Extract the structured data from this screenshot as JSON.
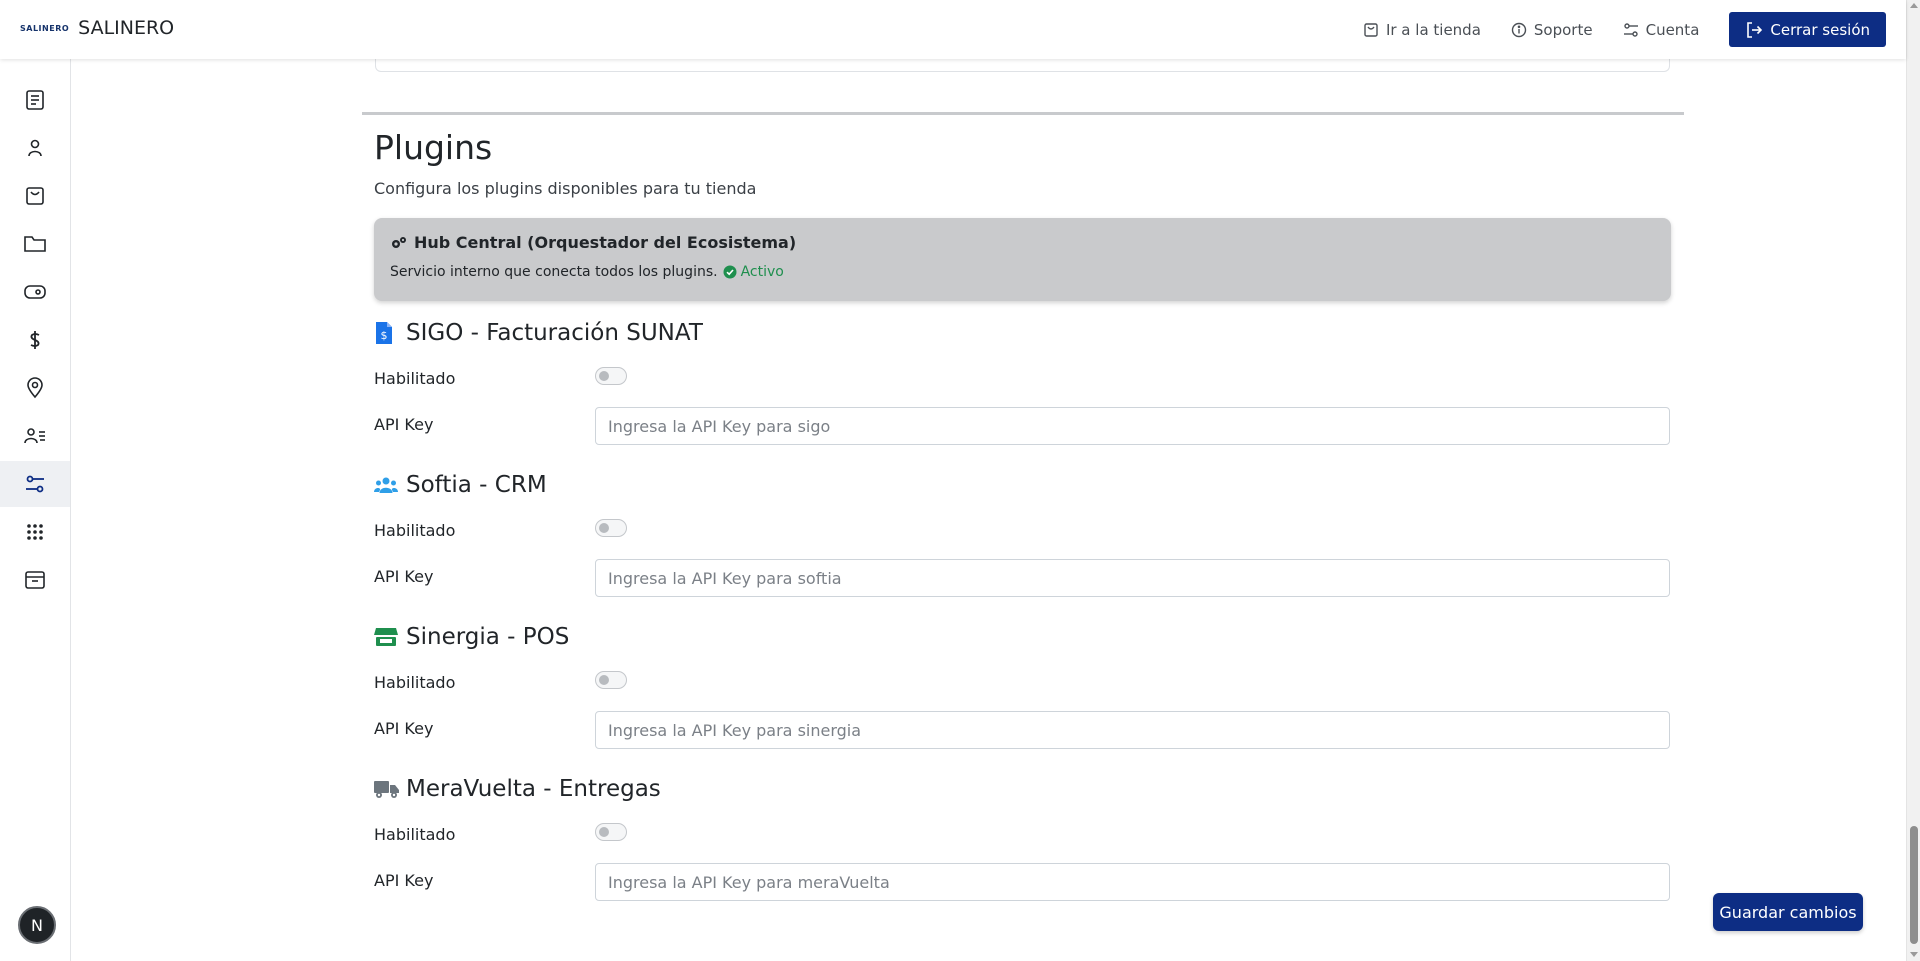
{
  "header": {
    "logo_text": "SALINERO",
    "brand_name": "SALINERO",
    "nav": {
      "store": "Ir a la tienda",
      "support": "Soporte",
      "account": "Cuenta",
      "logout": "Cerrar sesión"
    }
  },
  "sidebar": {
    "items": [
      {
        "icon": "document-list-icon"
      },
      {
        "icon": "user-icon"
      },
      {
        "icon": "shopping-bag-icon"
      },
      {
        "icon": "folder-icon"
      },
      {
        "icon": "tag-icon"
      },
      {
        "icon": "dollar-icon"
      },
      {
        "icon": "location-pin-icon"
      },
      {
        "icon": "users-list-icon"
      },
      {
        "icon": "settings-sliders-icon",
        "active": true
      },
      {
        "icon": "apps-grid-icon"
      },
      {
        "icon": "archive-box-icon"
      }
    ],
    "avatar_initial": "N"
  },
  "plugins": {
    "title": "Plugins",
    "subtitle": "Configura los plugins disponibles para tu tienda",
    "hub": {
      "title": "Hub Central (Orquestador del Ecosistema)",
      "description": "Servicio interno que conecta todos los plugins.",
      "status": "Activo",
      "status_color": "#1f8f4e"
    },
    "items": [
      {
        "name": "SIGO - Facturación SUNAT",
        "icon": "invoice-icon",
        "icon_color": "#1a73e8",
        "enabled_label": "Habilitado",
        "enabled": false,
        "api_label": "API Key",
        "api_placeholder": "Ingresa la API Key para sigo",
        "api_value": ""
      },
      {
        "name": "Softia - CRM",
        "icon": "users-group-icon",
        "icon_color": "#2f9fe8",
        "enabled_label": "Habilitado",
        "enabled": false,
        "api_label": "API Key",
        "api_placeholder": "Ingresa la API Key para softia",
        "api_value": ""
      },
      {
        "name": "Sinergia - POS",
        "icon": "store-icon",
        "icon_color": "#1f8f4e",
        "enabled_label": "Habilitado",
        "enabled": false,
        "api_label": "API Key",
        "api_placeholder": "Ingresa la API Key para sinergia",
        "api_value": ""
      },
      {
        "name": "MeraVuelta - Entregas",
        "icon": "truck-icon",
        "icon_color": "#6c757d",
        "enabled_label": "Habilitado",
        "enabled": false,
        "api_label": "API Key",
        "api_placeholder": "Ingresa la API Key para meraVuelta",
        "api_value": ""
      }
    ],
    "save_label": "Guardar cambios"
  },
  "colors": {
    "primary": "#0d2d84",
    "hub_background": "#c9cacc"
  }
}
